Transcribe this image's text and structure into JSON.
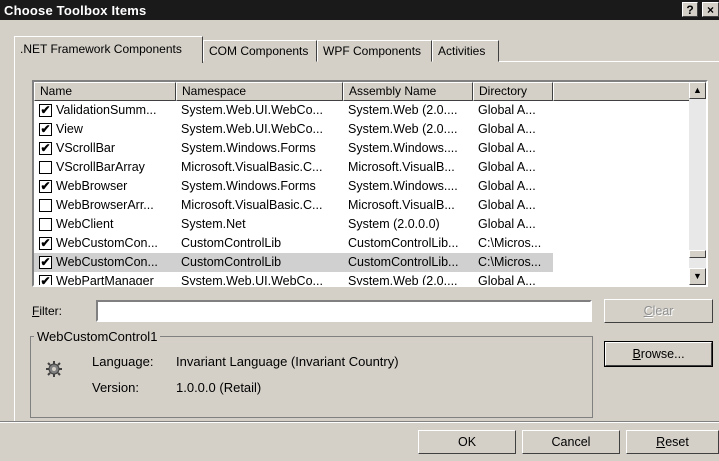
{
  "window": {
    "title": "Choose Toolbox Items",
    "help_label": "?",
    "close_label": "×"
  },
  "tabs": [
    {
      "label": ".NET Framework Components",
      "active": true
    },
    {
      "label": "COM Components",
      "active": false
    },
    {
      "label": "WPF Components",
      "active": false
    },
    {
      "label": "Activities",
      "active": false
    }
  ],
  "list": {
    "columns": [
      "Name",
      "Namespace",
      "Assembly Name",
      "Directory"
    ],
    "rows": [
      {
        "checked": true,
        "name": "ValidationSumm...",
        "namespace": "System.Web.UI.WebCo...",
        "assembly": "System.Web (2.0....",
        "directory": "Global A..."
      },
      {
        "checked": true,
        "name": "View",
        "namespace": "System.Web.UI.WebCo...",
        "assembly": "System.Web (2.0....",
        "directory": "Global A..."
      },
      {
        "checked": true,
        "name": "VScrollBar",
        "namespace": "System.Windows.Forms",
        "assembly": "System.Windows....",
        "directory": "Global A..."
      },
      {
        "checked": false,
        "name": "VScrollBarArray",
        "namespace": "Microsoft.VisualBasic.C...",
        "assembly": "Microsoft.VisualB...",
        "directory": "Global A..."
      },
      {
        "checked": true,
        "name": "WebBrowser",
        "namespace": "System.Windows.Forms",
        "assembly": "System.Windows....",
        "directory": "Global A..."
      },
      {
        "checked": false,
        "name": "WebBrowserArr...",
        "namespace": "Microsoft.VisualBasic.C...",
        "assembly": "Microsoft.VisualB...",
        "directory": "Global A..."
      },
      {
        "checked": false,
        "name": "WebClient",
        "namespace": "System.Net",
        "assembly": "System (2.0.0.0)",
        "directory": "Global A..."
      },
      {
        "checked": true,
        "name": "WebCustomCon...",
        "namespace": "CustomControlLib",
        "assembly": "CustomControlLib...",
        "directory": "C:\\Micros..."
      },
      {
        "checked": true,
        "name": "WebCustomCon...",
        "namespace": "CustomControlLib",
        "assembly": "CustomControlLib...",
        "directory": "C:\\Micros...",
        "selected": true
      },
      {
        "checked": true,
        "name": "WebPartManager",
        "namespace": "System.Web.UI.WebCo...",
        "assembly": "System.Web (2.0....",
        "directory": "Global A..."
      }
    ]
  },
  "filter": {
    "label_prefix": "",
    "label_accel": "F",
    "label_rest": "ilter:",
    "value": ""
  },
  "buttons": {
    "clear": {
      "accel": "C",
      "rest": "lear"
    },
    "browse": {
      "accel": "B",
      "rest": "rowse..."
    },
    "ok": "OK",
    "cancel": "Cancel",
    "reset": {
      "accel": "R",
      "rest": "eset"
    }
  },
  "details": {
    "title": "WebCustomControl1",
    "language_label": "Language:",
    "language_value": "Invariant Language (Invariant Country)",
    "version_label": "Version:",
    "version_value": "1.0.0.0 (Retail)",
    "icon": "gear-icon"
  },
  "scroll": {
    "up": "▲",
    "down": "▼"
  },
  "check_glyph": "✔"
}
